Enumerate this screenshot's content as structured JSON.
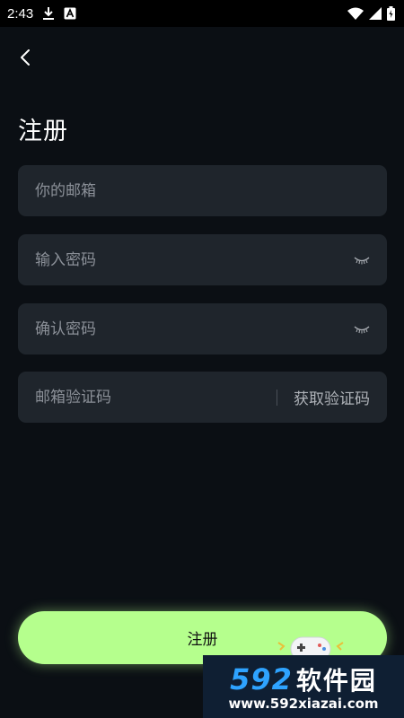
{
  "status_bar": {
    "time": "2:43",
    "icons": [
      "download-icon",
      "a-badge-icon",
      "wifi-icon",
      "signal-icon",
      "battery-icon"
    ]
  },
  "header": {
    "back_icon": "chevron-left-icon",
    "title": "注册"
  },
  "form": {
    "email": {
      "placeholder": "你的邮箱",
      "value": ""
    },
    "password": {
      "placeholder": "输入密码",
      "value": "",
      "toggle_icon": "eye-closed-icon"
    },
    "confirm_password": {
      "placeholder": "确认密码",
      "value": "",
      "toggle_icon": "eye-closed-icon"
    },
    "email_code": {
      "placeholder": "邮箱验证码",
      "value": "",
      "get_code_label": "获取验证码"
    }
  },
  "submit": {
    "label": "注册"
  },
  "watermark": {
    "brand_number": "592",
    "brand_text": "软件园",
    "url": "www.592xiazai.com"
  },
  "colors": {
    "background": "#0b0f14",
    "field_background": "#1f252c",
    "placeholder": "#8b9098",
    "accent": "#b5ff8d"
  }
}
